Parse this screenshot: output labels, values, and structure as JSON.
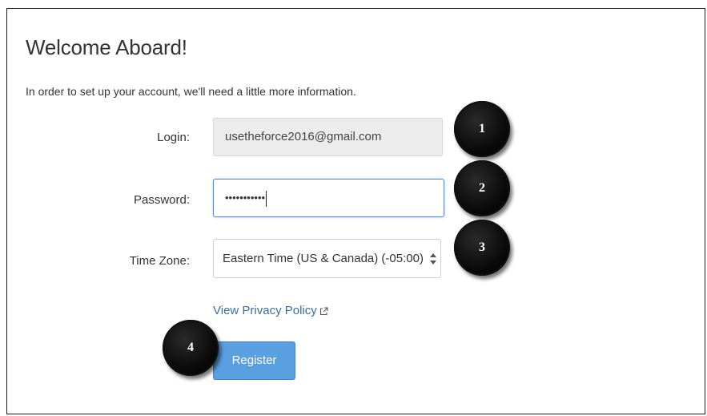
{
  "header": {
    "title": "Welcome Aboard!",
    "intro": "In order to set up your account, we'll need a little more information."
  },
  "form": {
    "login": {
      "label": "Login:",
      "value": "usetheforce2016@gmail.com"
    },
    "password": {
      "label": "Password:",
      "masked_value": "•••••••••••"
    },
    "time_zone": {
      "label": "Time Zone:",
      "selected": "Eastern Time (US & Canada) (-05:00)"
    },
    "privacy_link": "View Privacy Policy",
    "register_label": "Register"
  },
  "markers": [
    "1",
    "2",
    "3",
    "4"
  ],
  "colors": {
    "accent": "#5a9fe0",
    "link": "#3a6ea5",
    "focus_border": "#4a90d9"
  },
  "icons": {
    "external_link": "external-link-icon",
    "select_arrows": "chevron-up-down-icon"
  }
}
